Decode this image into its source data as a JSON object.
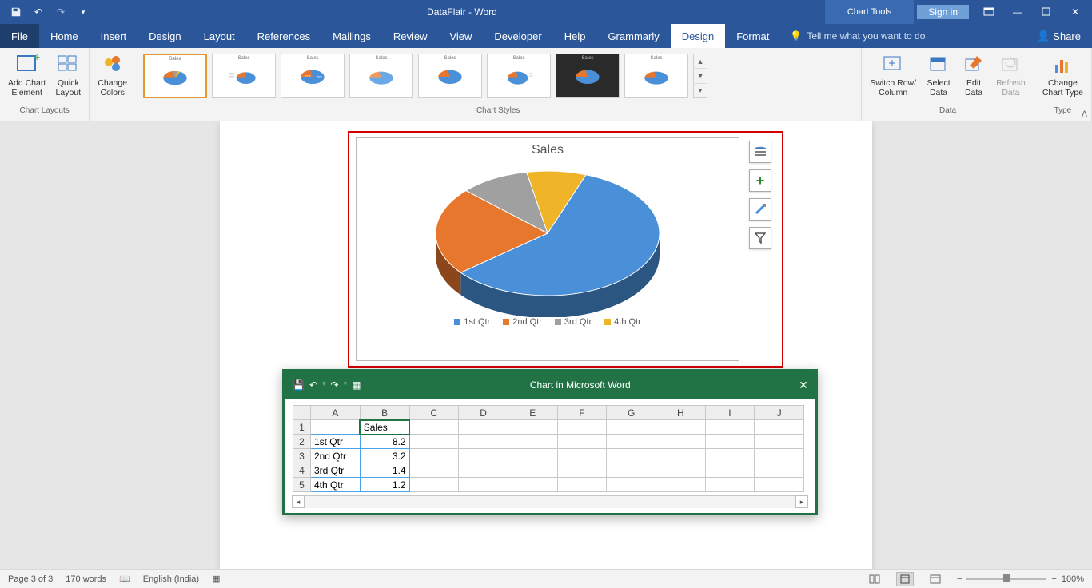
{
  "titlebar": {
    "doc_title": "DataFlair - Word",
    "chart_tools": "Chart Tools",
    "signin": "Sign in"
  },
  "tabs": {
    "file": "File",
    "home": "Home",
    "insert": "Insert",
    "design": "Design",
    "layout": "Layout",
    "references": "References",
    "mailings": "Mailings",
    "review": "Review",
    "view": "View",
    "developer": "Developer",
    "help": "Help",
    "grammarly": "Grammarly",
    "ct_design": "Design",
    "ct_format": "Format",
    "tell_me": "Tell me what you want to do",
    "share": "Share"
  },
  "ribbon": {
    "add_element": "Add Chart\nElement",
    "quick_layout": "Quick\nLayout",
    "change_colors": "Change\nColors",
    "group_chart_layouts": "Chart Layouts",
    "group_chart_styles": "Chart Styles",
    "switch": "Switch Row/\nColumn",
    "select_data": "Select\nData",
    "edit_data": "Edit\nData",
    "refresh_data": "Refresh\nData",
    "group_data": "Data",
    "change_type": "Change\nChart Type",
    "group_type": "Type"
  },
  "chart": {
    "title": "Sales",
    "legend": [
      "1st Qtr",
      "2nd Qtr",
      "3rd Qtr",
      "4th Qtr"
    ]
  },
  "mini_xl": {
    "title": "Chart in Microsoft Word",
    "cols": [
      "A",
      "B",
      "C",
      "D",
      "E",
      "F",
      "G",
      "H",
      "I",
      "J"
    ],
    "rows": {
      "1": {
        "B": "Sales"
      },
      "2": {
        "A": "1st Qtr",
        "B": "8.2"
      },
      "3": {
        "A": "2nd Qtr",
        "B": "3.2"
      },
      "4": {
        "A": "3rd Qtr",
        "B": "1.4"
      },
      "5": {
        "A": "4th Qtr",
        "B": "1.2"
      }
    }
  },
  "status": {
    "page": "Page 3 of 3",
    "words": "170 words",
    "lang": "English (India)",
    "zoom": "100%"
  },
  "colors": {
    "q1": "#4a90d9",
    "q2": "#e8772e",
    "q3": "#a0a0a0",
    "q4": "#f0b429"
  },
  "chart_data": {
    "type": "pie",
    "title": "Sales",
    "categories": [
      "1st Qtr",
      "2nd Qtr",
      "3rd Qtr",
      "4th Qtr"
    ],
    "values": [
      8.2,
      3.2,
      1.4,
      1.2
    ],
    "series_name": "Sales",
    "colors": [
      "#4a90d9",
      "#e8772e",
      "#a0a0a0",
      "#f0b429"
    ],
    "style": "3d",
    "legend_position": "bottom"
  }
}
